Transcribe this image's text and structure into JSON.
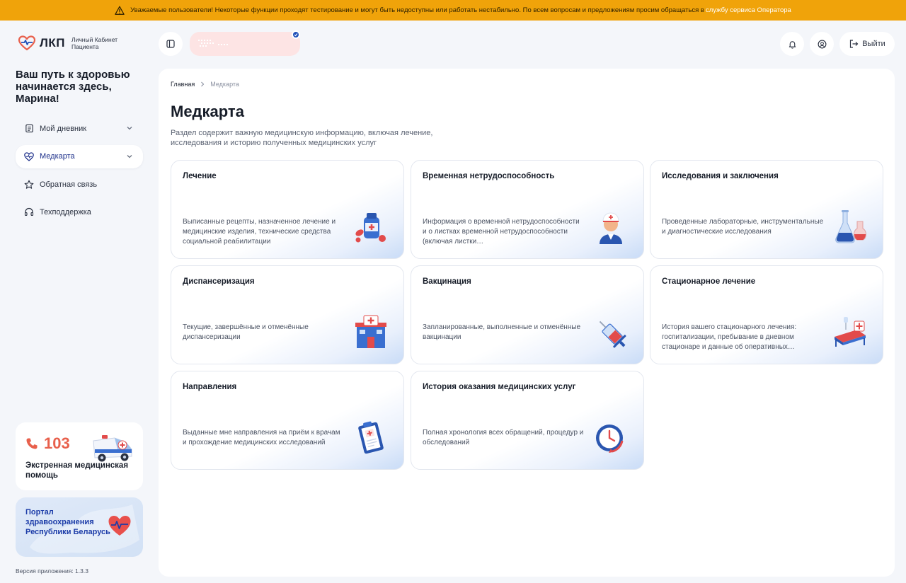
{
  "banner": {
    "text": "Уважаемые пользователи! Некоторые функции проходят тестирование и могут быть недоступны или работать нестабильно. По всем вопросам и предложениям просим обращаться в",
    "link": "службу сервиса Оператора"
  },
  "sidebar": {
    "logo_text": "ЛКП",
    "logo_subtitle": "Личный Кабинет Пациента",
    "greeting": "Ваш путь к здоровью начинается здесь, Марина!",
    "items": [
      {
        "label": "Мой дневник",
        "icon": "diary-icon"
      },
      {
        "label": "Медкарта",
        "icon": "heart-icon"
      },
      {
        "label": "Обратная связь",
        "icon": "star-icon"
      },
      {
        "label": "Техподдержка",
        "icon": "headset-icon"
      }
    ],
    "emergency": {
      "number": "103",
      "label": "Экстренная медицинская помощь"
    },
    "portal": {
      "label": "Портал здравоохранения Республики Беларусь"
    },
    "version": "Версия приложения: 1.3.3"
  },
  "header": {
    "logout_label": "Выйти"
  },
  "breadcrumb": {
    "home": "Главная",
    "current": "Медкарта"
  },
  "page": {
    "title": "Медкарта",
    "description": "Раздел содержит важную медицинскую информацию, включая лечение, исследования и историю полученных медицинских услуг"
  },
  "cards": [
    {
      "title": "Лечение",
      "desc": "Выписанные рецепты, назначенное лечение и медицинские изделия, технические средства социальной реабилитации",
      "icon": "medicine-icon"
    },
    {
      "title": "Временная нетрудоспособность",
      "desc": "Информация о временной нетрудоспособности и о листках временной нетрудоспособности (включая листки…",
      "icon": "doctor-icon"
    },
    {
      "title": "Исследования и заключения",
      "desc": "Проведенные лабораторные, инструментальные и диагностические исследования",
      "icon": "flasks-icon"
    },
    {
      "title": "Диспансеризация",
      "desc": "Текущие, завершённые и отменённые диспансеризации",
      "icon": "hospital-icon"
    },
    {
      "title": "Вакцинация",
      "desc": "Запланированные, выполненные и отменённые вакцинации",
      "icon": "syringe-icon"
    },
    {
      "title": "Стационарное лечение",
      "desc": "История вашего стационарного лечения: госпитализации, пребывание в дневном стационаре и данные об оперативных…",
      "icon": "hospital-bed-icon"
    },
    {
      "title": "Направления",
      "desc": "Выданные мне направления на приём к врачам и прохождение медицинских исследований",
      "icon": "clipboard-icon"
    },
    {
      "title": "История оказания медицинских услуг",
      "desc": "Полная хронология всех обращений, процедур и обследований",
      "icon": "history-clock-icon"
    }
  ]
}
